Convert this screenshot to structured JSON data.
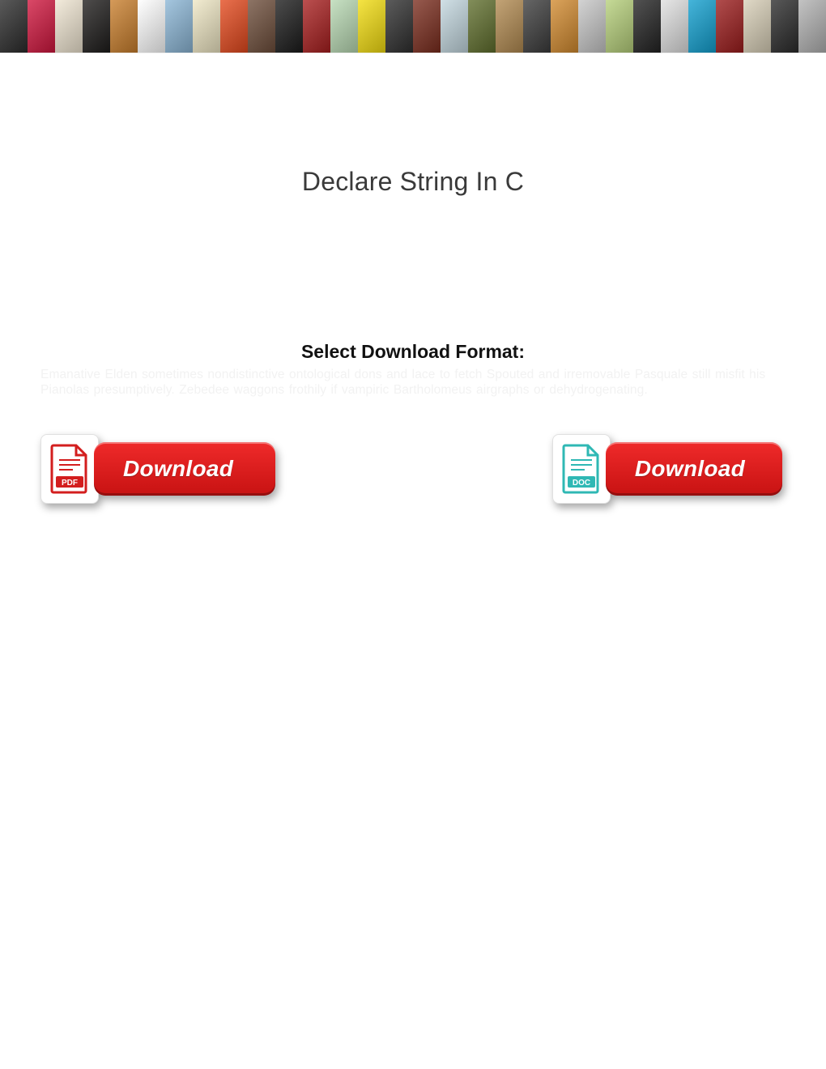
{
  "title": "Declare String In C",
  "format_heading": "Select Download Format:",
  "ghost_text": "Emanative Elden sometimes nondistinctive ontological dons and lace to fetch   Spouted and irremovable Pasquale still misfit his Pianolas presumptively. Zebedee waggons frothily if vampiric Bartholomeus airgraphs or dehydrogenating.",
  "buttons": {
    "pdf": {
      "label": "Download",
      "icon": "PDF",
      "icon_color": "#d31e1e"
    },
    "doc": {
      "label": "Download",
      "icon": "DOC",
      "icon_color": "#2fb8b4"
    }
  }
}
